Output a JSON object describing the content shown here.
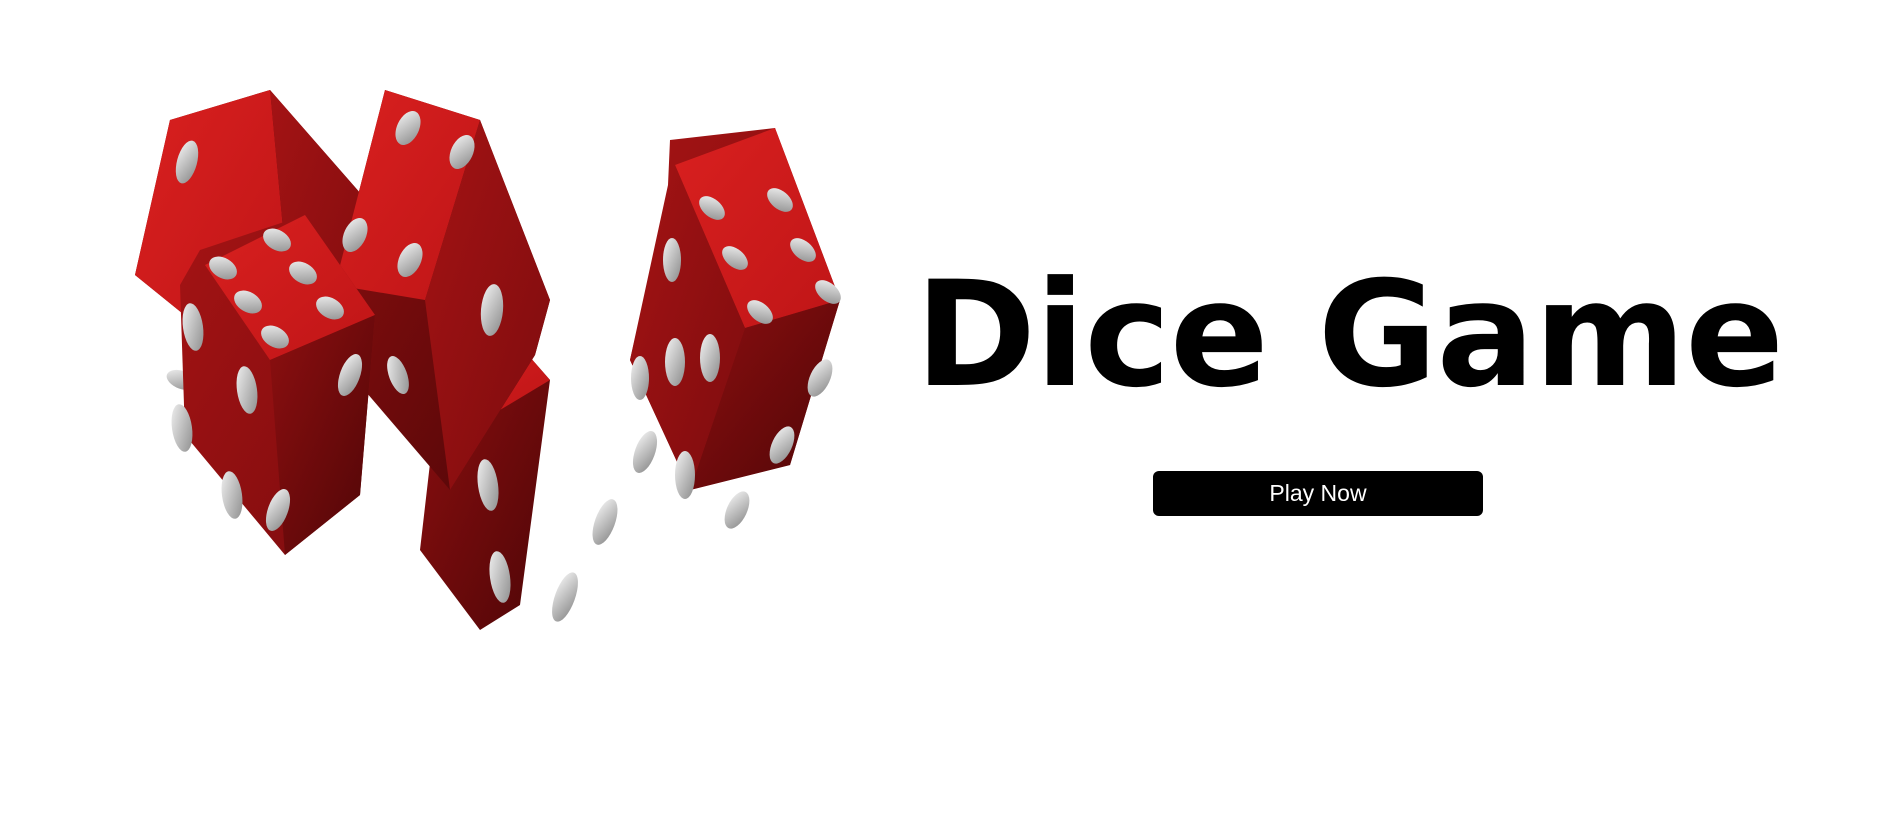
{
  "hero": {
    "title": "Dice Game",
    "play_button_label": "Play Now"
  },
  "illustration": {
    "icon": "dice-cluster-icon",
    "dice_color": "#c8181a",
    "pip_color": "#e6e6e6"
  },
  "colors": {
    "background": "#ffffff",
    "title": "#000000",
    "button_bg": "#000000",
    "button_text": "#ffffff"
  }
}
